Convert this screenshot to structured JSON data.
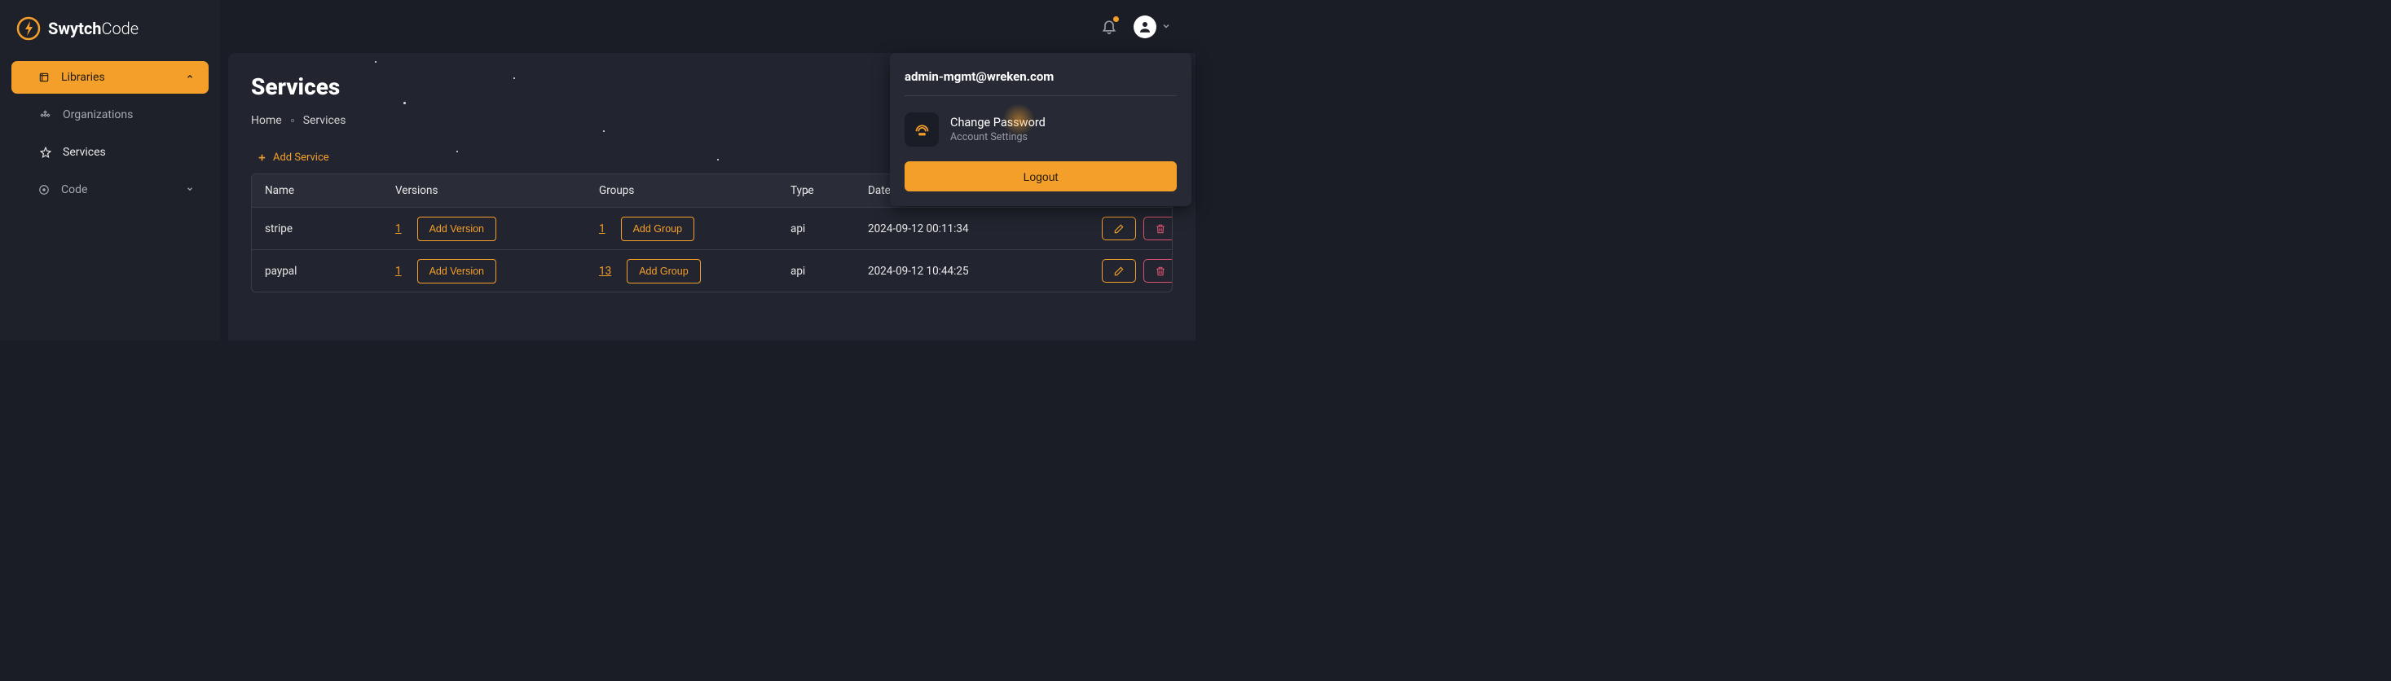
{
  "brand": {
    "name_bold": "Swytch",
    "name_light": "Code"
  },
  "sidebar": {
    "items": [
      {
        "label": "Libraries",
        "icon": "layers-icon",
        "active": true,
        "chevron": "up"
      },
      {
        "label": "Organizations",
        "icon": "nodes-icon",
        "active": false,
        "chevron": null,
        "sub": true
      },
      {
        "label": "Services",
        "icon": "star-icon",
        "active": false,
        "chevron": null,
        "sub": true
      },
      {
        "label": "Code",
        "icon": "scan-icon",
        "active": false,
        "chevron": "down"
      }
    ]
  },
  "page": {
    "title": "Services",
    "breadcrumb": [
      "Home",
      "Services"
    ],
    "add_service_label": "Add Service"
  },
  "table": {
    "headers": [
      "Name",
      "Versions",
      "Groups",
      "Type",
      "Date Created",
      ""
    ],
    "add_version_label": "Add Version",
    "add_group_label": "Add Group",
    "rows": [
      {
        "name": "stripe",
        "versions": "1",
        "groups": "1",
        "type": "api",
        "created": "2024-09-12 00:11:34"
      },
      {
        "name": "paypal",
        "versions": "1",
        "groups": "13",
        "type": "api",
        "created": "2024-09-12 10:44:25"
      }
    ]
  },
  "user_menu": {
    "email": "admin-mgmt@wreken.com",
    "change_password_label": "Change Password",
    "account_settings_label": "Account Settings",
    "logout_label": "Logout"
  },
  "colors": {
    "accent": "#f49f29",
    "danger": "#d9536f"
  }
}
